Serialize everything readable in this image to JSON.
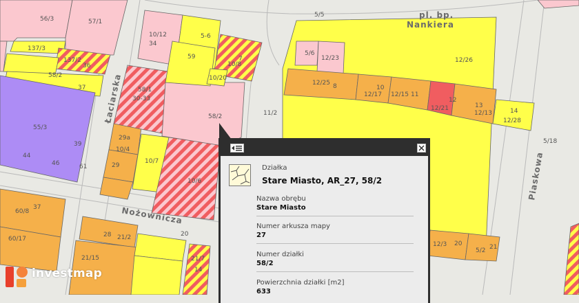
{
  "map": {
    "streets": {
      "laciarska": "Łaciarska",
      "nozownicza": "Nożownicza",
      "piaskowa": "Piaskowa",
      "plac_line1": "pl. bp.",
      "plac_line2": "Nankiera"
    },
    "parcels": [
      {
        "id": "56/3",
        "label": "56/3"
      },
      {
        "id": "57/1",
        "label": "57/1"
      },
      {
        "id": "137/3",
        "label": "137/3"
      },
      {
        "id": "137/2",
        "label": "137/2"
      },
      {
        "id": "36",
        "label": "36"
      },
      {
        "id": "58/2a",
        "label": "58/2"
      },
      {
        "id": "37",
        "label": "37"
      },
      {
        "id": "55/3",
        "label": "55/3"
      },
      {
        "id": "44",
        "label": "44"
      },
      {
        "id": "46",
        "label": "46"
      },
      {
        "id": "39",
        "label": "39"
      },
      {
        "id": "29a",
        "label": "29a"
      },
      {
        "id": "10/4",
        "label": "10/4"
      },
      {
        "id": "29",
        "label": "29"
      },
      {
        "id": "10/7",
        "label": "10/7"
      },
      {
        "id": "10/6",
        "label": "10/6"
      },
      {
        "id": "61",
        "label": "61"
      },
      {
        "id": "10/12",
        "label": "10/12"
      },
      {
        "id": "34",
        "label": "34"
      },
      {
        "id": "5-6",
        "label": "5-6"
      },
      {
        "id": "59",
        "label": "59"
      },
      {
        "id": "10/8",
        "label": "10/8"
      },
      {
        "id": "7",
        "label": "7"
      },
      {
        "id": "10/20",
        "label": "10/20"
      },
      {
        "id": "58/1",
        "label": "58/1"
      },
      {
        "id": "30-33",
        "label": "30-33"
      },
      {
        "id": "58/2",
        "label": "58/2"
      },
      {
        "id": "60/8",
        "label": "60/8"
      },
      {
        "id": "37b",
        "label": "37"
      },
      {
        "id": "60/17",
        "label": "60/17"
      },
      {
        "id": "28",
        "label": "28"
      },
      {
        "id": "21/2",
        "label": "21/2"
      },
      {
        "id": "20",
        "label": "20"
      },
      {
        "id": "21/15",
        "label": "21/15"
      },
      {
        "id": "21/7",
        "label": "21/7"
      },
      {
        "id": "14",
        "label": "14"
      },
      {
        "id": "5/5",
        "label": "5/5"
      },
      {
        "id": "5/6",
        "label": "5/6"
      },
      {
        "id": "12/23",
        "label": "12/23"
      },
      {
        "id": "12/26",
        "label": "12/26"
      },
      {
        "id": "12/25",
        "label": "12/25"
      },
      {
        "id": "8",
        "label": "8"
      },
      {
        "id": "10",
        "label": "10"
      },
      {
        "id": "12/17",
        "label": "12/17"
      },
      {
        "id": "12/15",
        "label": "12/15"
      },
      {
        "id": "11",
        "label": "11"
      },
      {
        "id": "12",
        "label": "12"
      },
      {
        "id": "12/21",
        "label": "12/21"
      },
      {
        "id": "13",
        "label": "13"
      },
      {
        "id": "12/13",
        "label": "12/13"
      },
      {
        "id": "14b",
        "label": "14"
      },
      {
        "id": "12/28",
        "label": "12/28"
      },
      {
        "id": "11/2",
        "label": "11/2"
      },
      {
        "id": "5/18",
        "label": "5/18"
      },
      {
        "id": "12/3",
        "label": "12/3"
      },
      {
        "id": "20b",
        "label": "20"
      },
      {
        "id": "5/2",
        "label": "5/2"
      },
      {
        "id": "21",
        "label": "21"
      }
    ]
  },
  "popup": {
    "type_label": "Działka",
    "title": "Stare Miasto, AR_27, 58/2",
    "fields": [
      {
        "label": "Nazwa obrębu",
        "value": "Stare Miasto"
      },
      {
        "label": "Numer arkusza mapy",
        "value": "27"
      },
      {
        "label": "Numer działki",
        "value": "58/2"
      },
      {
        "label": "Powierzchnia działki [m2]",
        "value": "633"
      }
    ]
  },
  "logo": {
    "text": "investmap"
  },
  "colors": {
    "residential_yellow": "#ffff4a",
    "service_orange": "#f5b04a",
    "light_pink": "#fbc8cf",
    "violet": "#ad8cf5",
    "red_hatch": "#f05d60",
    "road_gray": "#e9e9e4",
    "popup_dark": "#2e2e2e",
    "logo_red": "#e8402b"
  }
}
